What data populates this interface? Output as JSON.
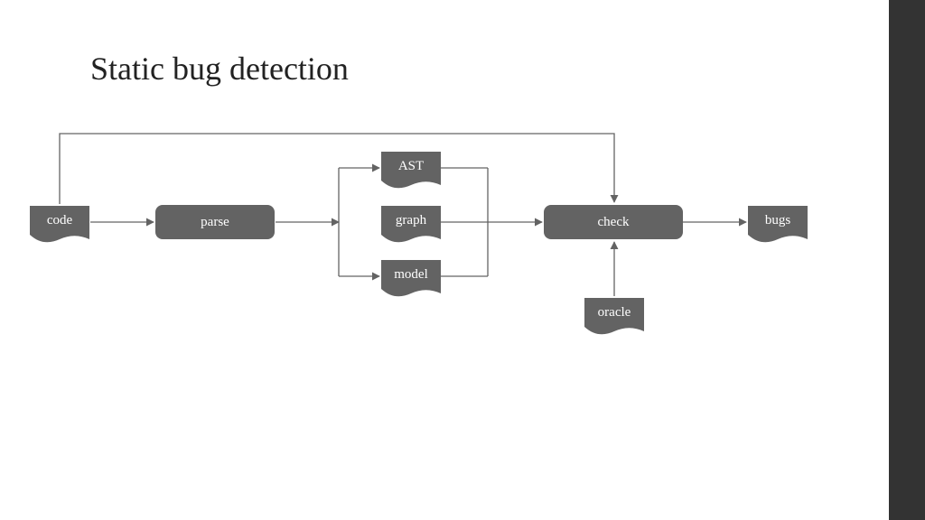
{
  "title": "Static bug detection",
  "nodes": {
    "code": "code",
    "parse": "parse",
    "ast": "AST",
    "graph": "graph",
    "model": "model",
    "check": "check",
    "oracle": "oracle",
    "bugs": "bugs"
  },
  "colors": {
    "node_fill": "#636363",
    "node_text": "#ffffff",
    "arrow": "#636363",
    "sidebar": "#333333"
  }
}
